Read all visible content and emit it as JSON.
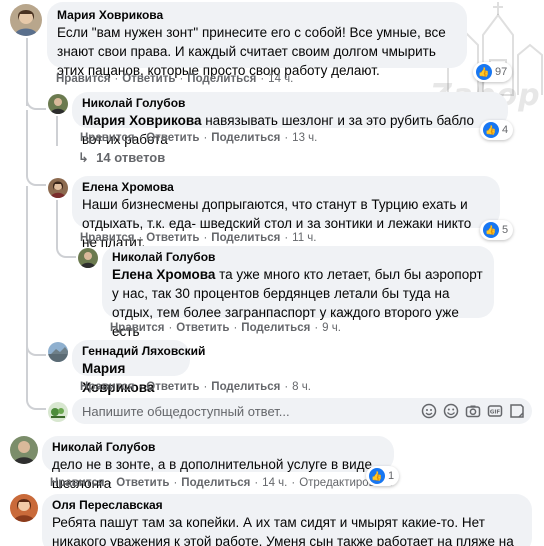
{
  "watermark": {
    "text": "Zabop"
  },
  "comments": [
    {
      "author": "Мария Ховрикова",
      "text": "Если \"вам нужен зонт\" принесите его с собой! Все умные, все знают свои права. И каждый считает своим долгом чмырить этих пацанов, которые просто свою работу делают.",
      "like": "Нравится",
      "reply": "Ответить",
      "share": "Поделиться",
      "time": "14 ч.",
      "reactions": "97"
    },
    {
      "author": "Николай Голубов",
      "mention": "Мария Ховрикова",
      "text": " навязывать шезлонг и за это рубить бабло вот их работа",
      "like": "Нравится",
      "reply": "Ответить",
      "share": "Поделиться",
      "time": "13 ч.",
      "reactions": "4"
    },
    {
      "replies_label": "14 ответов"
    },
    {
      "author": "Елена Хромова",
      "text": "Наши бизнесмены допрыгаются, что станут в Турцию ехать и отдыхать, т.к. еда- шведский стол и за зонтики и лежаки никто не платит.",
      "like": "Нравится",
      "reply": "Ответить",
      "share": "Поделиться",
      "time": "11 ч.",
      "reactions": "5"
    },
    {
      "author": "Николай Голубов",
      "mention": "Елена Хромова",
      "text": " та уже много кто летает, был бы аэропорт у нас, так 30 процентов бердянцев летали бы туда на отдых, тем более загранпаспорт у каждого второго уже есть",
      "like": "Нравится",
      "reply": "Ответить",
      "share": "Поделиться",
      "time": "9 ч."
    },
    {
      "author": "Геннадий Ляховский",
      "mention": "Мария Ховрикова",
      "like": "Нравится",
      "reply": "Ответить",
      "share": "Поделиться",
      "time": "8 ч."
    },
    {
      "author": "Николай Голубов",
      "text": "дело не в зонте, а в дополнительной услуге в виде шезлонга",
      "like": "Нравится",
      "reply": "Ответить",
      "share": "Поделиться",
      "time": "14 ч.",
      "edited": "Отредактировано",
      "reactions": "1"
    },
    {
      "author": "Оля Переславская",
      "text": "Ребята пашут там за копейки. А их там сидят и чмырят какие-то. Нет никакого уважения к этой работе. Уменя сын также работает на пляже на базе и я не"
    }
  ],
  "reply_box": {
    "placeholder": "Напишите общедоступный ответ...",
    "icons": [
      "sticker-icon",
      "emoji-icon",
      "camera-icon",
      "gif-icon",
      "sticker-alt-icon"
    ]
  }
}
